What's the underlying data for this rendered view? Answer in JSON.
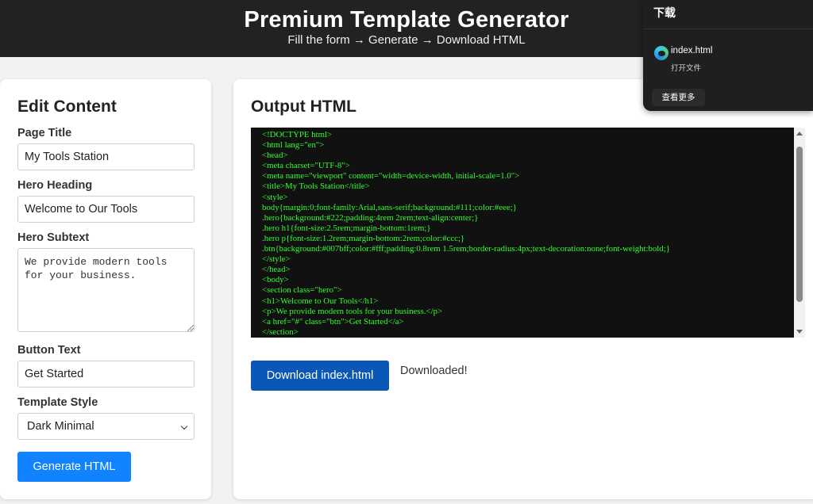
{
  "header": {
    "title": "Premium Template Generator",
    "subtitle": "Fill the form → Generate → Download HTML"
  },
  "editor": {
    "title": "Edit Content",
    "page_title_label": "Page Title",
    "page_title_value": "My Tools Station",
    "hero_heading_label": "Hero Heading",
    "hero_heading_value": "Welcome to Our Tools",
    "hero_subtext_label": "Hero Subtext",
    "hero_subtext_value": "We provide modern tools for your business.",
    "button_text_label": "Button Text",
    "button_text_value": "Get Started",
    "template_style_label": "Template Style",
    "template_style_value": "Dark Minimal",
    "generate_label": "Generate HTML"
  },
  "output": {
    "title": "Output HTML",
    "code_lines": [
      "<!DOCTYPE html>",
      "<html lang=\"en\">",
      "<head>",
      "<meta charset=\"UTF-8\">",
      "<meta name=\"viewport\" content=\"width=device-width, initial-scale=1.0\">",
      "<title>My Tools Station</title>",
      "<style>",
      "body{margin:0;font-family:Arial,sans-serif;background:#111;color:#eee;}",
      ".hero{background:#222;padding:4rem 2rem;text-align:center;}",
      ".hero h1{font-size:2.5rem;margin-bottom:1rem;}",
      ".hero p{font-size:1.2rem;margin-bottom:2rem;color:#ccc;}",
      ".btn{background:#007bff;color:#fff;padding:0.8rem 1.5rem;border-radius:4px;text-decoration:none;font-weight:bold;}",
      "</style>",
      "</head>",
      "<body>",
      "<section class=\"hero\">",
      "<h1>Welcome to Our Tools</h1>",
      "<p>We provide modern tools for your business.</p>",
      "<a href=\"#\" class=\"btn\">Get Started</a>",
      "</section>"
    ],
    "download_label": "Download index.html",
    "status": "Downloaded!"
  },
  "downloads_panel": {
    "title": "下载",
    "file_name": "index.html",
    "open_file": "打开文件",
    "see_more": "查看更多"
  },
  "colors": {
    "header_bg": "#222222",
    "primary_button": "#1183ff",
    "download_button": "#0b57b8",
    "code_text": "#30ff30",
    "code_bg": "#111111"
  }
}
